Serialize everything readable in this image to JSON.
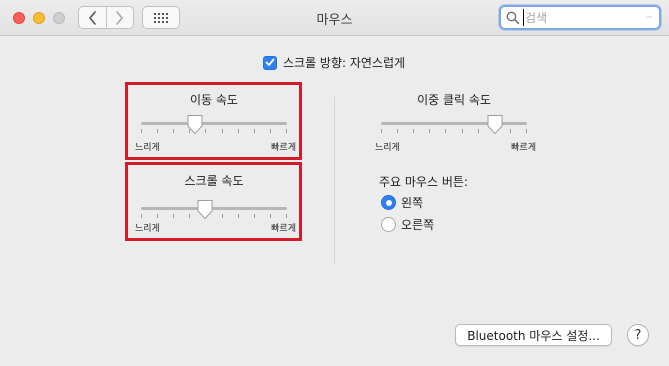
{
  "window": {
    "title": "마우스",
    "nav_back_icon": "chevron-left-icon",
    "nav_forward_icon": "chevron-right-icon",
    "show_all_icon": "grid-icon"
  },
  "search": {
    "placeholder": "검색",
    "value": ""
  },
  "scroll_direction": {
    "label": "스크롤 방향: 자연스럽게",
    "checked": true
  },
  "tracking_speed": {
    "label": "이동 속도",
    "min_label": "느리게",
    "max_label": "빠르게",
    "value": 0.37
  },
  "scroll_speed": {
    "label": "스크롤 속도",
    "min_label": "느리게",
    "max_label": "빠르게",
    "value": 0.44
  },
  "double_click_speed": {
    "label": "이중 클릭 속도",
    "min_label": "느리게",
    "max_label": "빠르게",
    "value": 0.78
  },
  "primary_button": {
    "label": "주요 마우스 버튼:",
    "options": [
      "왼쪽",
      "오른쪽"
    ],
    "selected": "왼쪽"
  },
  "buttons": {
    "bluetooth": "Bluetooth 마우스 설정...",
    "help": "?"
  },
  "colors": {
    "accent": "#2f7ff1",
    "highlight": "#d31b2a"
  }
}
